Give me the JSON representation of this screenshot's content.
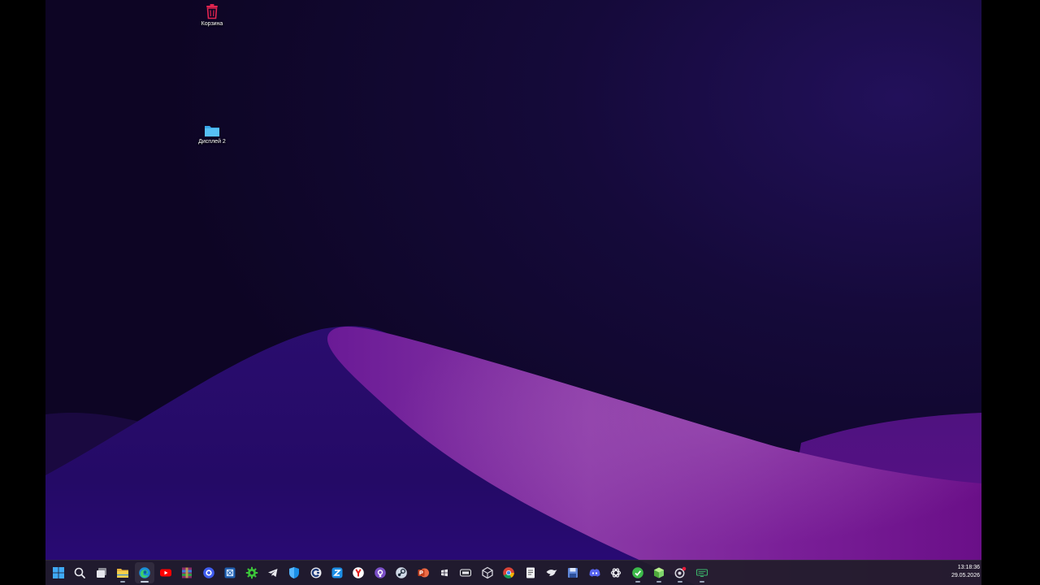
{
  "desktop": {
    "recycle_bin_label": "Корзина",
    "folder_label": "Дисплей 2"
  },
  "taskbar": {
    "apps": [
      {
        "name": "start-button",
        "icon": "windows-logo-icon"
      },
      {
        "name": "search-button",
        "icon": "search-icon"
      },
      {
        "name": "task-view-button",
        "icon": "task-view-icon"
      },
      {
        "name": "file-explorer-button",
        "icon": "folder-icon"
      },
      {
        "name": "edge-button",
        "icon": "edge-icon"
      },
      {
        "name": "youtube-button",
        "icon": "youtube-icon"
      },
      {
        "name": "winrar-button",
        "icon": "winrar-icon"
      },
      {
        "name": "messenger-button",
        "icon": "chat-bubble-icon"
      },
      {
        "name": "tool-button",
        "icon": "blue-square-icon"
      },
      {
        "name": "settings-button",
        "icon": "gear-icon"
      },
      {
        "name": "telegram-button",
        "icon": "telegram-icon"
      },
      {
        "name": "defender-button",
        "icon": "shield-icon"
      },
      {
        "name": "ccleaner-button",
        "icon": "ccleaner-icon"
      },
      {
        "name": "utility-button",
        "icon": "blue-tile-icon"
      },
      {
        "name": "yandex-browser-button",
        "icon": "yandex-icon"
      },
      {
        "name": "github-button",
        "icon": "github-icon"
      },
      {
        "name": "steam-button",
        "icon": "steam-icon"
      },
      {
        "name": "powerpoint-button",
        "icon": "powerpoint-icon"
      },
      {
        "name": "windows-app-button",
        "icon": "small-windows-icon"
      },
      {
        "name": "tray-app-button",
        "icon": "rounded-box-icon"
      },
      {
        "name": "unity-button",
        "icon": "cube-icon"
      },
      {
        "name": "chrome-button",
        "icon": "chrome-icon"
      },
      {
        "name": "notepad-button",
        "icon": "notepad-icon"
      },
      {
        "name": "eagle-app-button",
        "icon": "eagle-icon"
      },
      {
        "name": "save-app-button",
        "icon": "floppy-disk-icon"
      },
      {
        "name": "discord-button",
        "icon": "discord-icon"
      },
      {
        "name": "chatgpt-button",
        "icon": "openai-icon"
      },
      {
        "name": "green-app-button",
        "icon": "green-circle-icon"
      },
      {
        "name": "package-app-button",
        "icon": "package-icon"
      },
      {
        "name": "notification-app-button",
        "icon": "ring-with-badge-icon"
      },
      {
        "name": "monitor-app-button",
        "icon": "monitor-icon"
      }
    ],
    "clock_time": "13:18:36",
    "clock_date": "29.05.2026"
  },
  "colors": {
    "taskbar_bg": "#201c28",
    "wallpaper_dark": "#0d0524",
    "wallpaper_purple": "#8a3aa8",
    "wallpaper_indigo": "#2a0a7a"
  }
}
